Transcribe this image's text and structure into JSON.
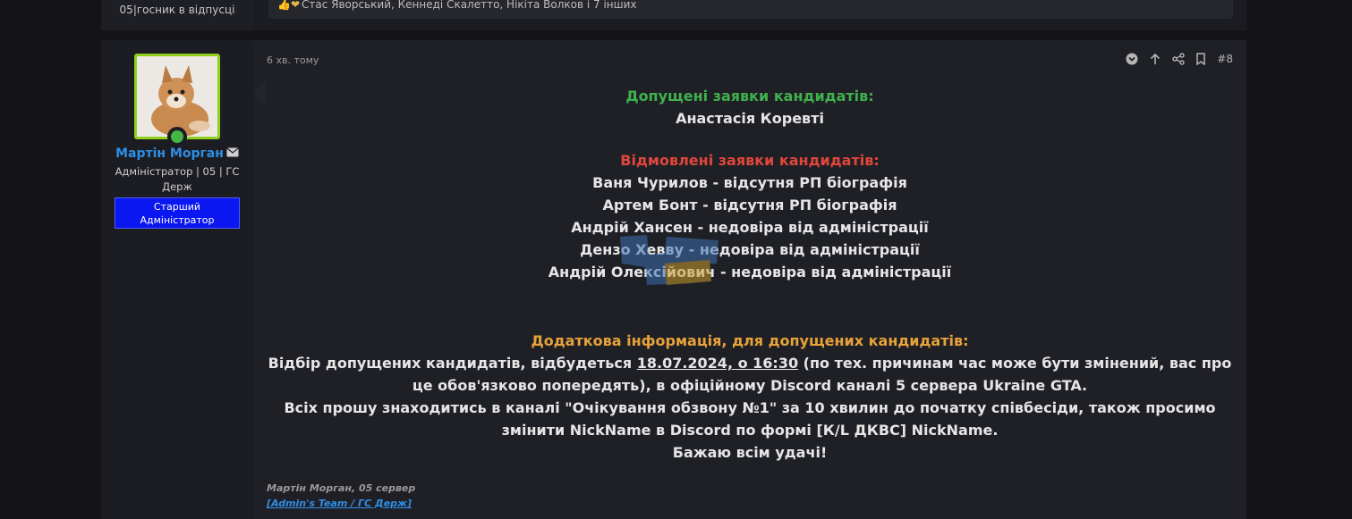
{
  "previous_post": {
    "user_title": "05|госник в відпусці",
    "reactions_text": "Стас Яворський, Кеннеді Скалетто, Нікіта Волков і 7 інших"
  },
  "post": {
    "time": "6 хв. тому",
    "number": "#8",
    "author": {
      "name": "Мартін Морган",
      "title": "Адміністратор | 05 | ГС Держ",
      "banner": "Старший Адміністратор"
    },
    "accepted": {
      "heading": "Допущені заявки кандидатів:",
      "names": [
        "Анастасія Коревті"
      ]
    },
    "rejected": {
      "heading": "Відмовлені заявки кандидатів:",
      "items": [
        "Ваня Чурилов - відсутня РП біографія",
        "Артем Бонт - відсутня РП біографія",
        "Андрій Хансен - недовіра від адміністрації",
        "Дензо Хевву - недовіра від адміністрації",
        "Андрій Олексійович - недовіра від адміністрації"
      ]
    },
    "info": {
      "heading": "Додаткова інформація, для допущених кандидатів:",
      "line1_before": "Відбір допущених кандидатів, відбудеться ",
      "line1_date": "18.07.2024, о 16:30",
      "line1_after": " (по тех. причинам час може бути змінений, вас про це обов'язково попередять), в офіційному Discord каналі 5 сервера Ukraine GTA.",
      "line2": "Всіх прошу знаходитись в каналі \"Очікування обзвону №1\" за 10 хвилин до початку співбесіди, також просимо змінити NickName в Discord по формі [К/L ДКВС] NickName.",
      "line3": "Бажаю всім удачі!"
    },
    "signature": {
      "line1": "Мартін Морган, 05 сервер",
      "link": "[Admin's Team / ГС Держ]"
    }
  },
  "colors": {
    "accepted": "#3fb14d",
    "rejected": "#e0463b",
    "info": "#e7a23a",
    "username": "#2f8ee6",
    "banner": "#0a17f0"
  },
  "icons": [
    "mail-icon",
    "online-status-icon",
    "chevron-down-circle-icon",
    "arrow-up-icon",
    "share-icon",
    "bookmark-icon"
  ]
}
